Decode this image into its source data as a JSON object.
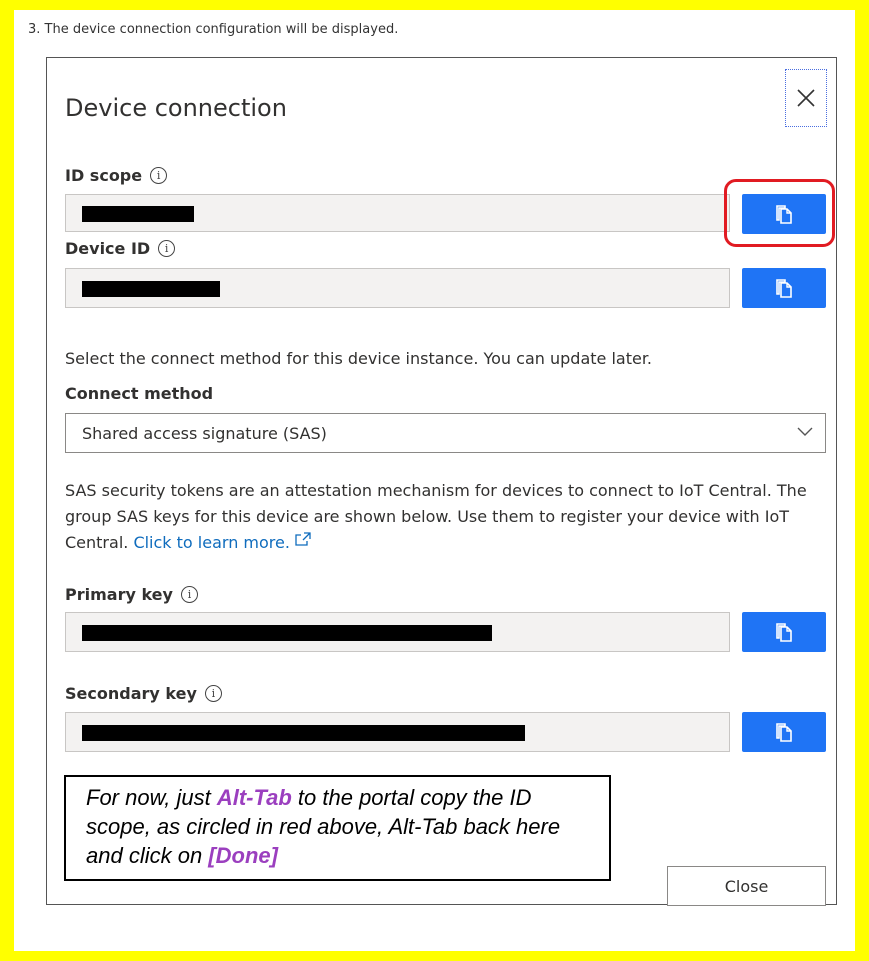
{
  "step_text": "3. The device connection configuration will be displayed.",
  "dialog": {
    "title": "Device connection",
    "close_icon": "close-icon"
  },
  "fields": {
    "id_scope_label": "ID scope",
    "device_id_label": "Device ID",
    "primary_key_label": "Primary key",
    "secondary_key_label": "Secondary key",
    "info_glyph": "i"
  },
  "connect": {
    "instruction": "Select the connect method for this device instance. You can update later.",
    "method_label": "Connect method",
    "method_value": "Shared access signature (SAS)",
    "sas_description": "SAS security tokens are an attestation mechanism for devices to connect to IoT Central. The group SAS keys for this device are shown below. Use them to register your device with IoT Central.",
    "learn_more": "Click to learn more."
  },
  "callout": {
    "part1": "For now, just ",
    "alt_tab": "Alt-Tab",
    "part2": " to the portal copy the ID scope, as circled in red above, Alt-Tab back here and click on ",
    "done": "[Done]"
  },
  "close_button_label": "Close",
  "colors": {
    "background_frame": "#ffff00",
    "copy_button": "#1f74f5",
    "highlight_circle": "#e11b22",
    "callout_highlight": "#9b3fbf",
    "link": "#0f6cbd"
  }
}
